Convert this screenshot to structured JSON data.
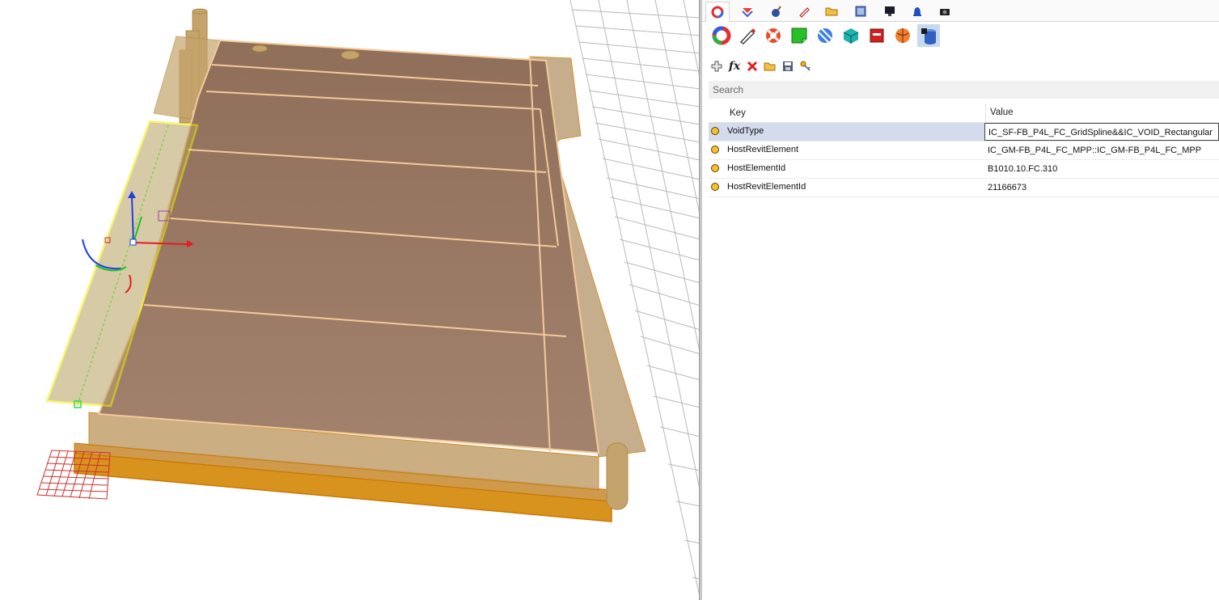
{
  "colors": {
    "accent": "#f6c12c",
    "selection": "#d3dbed",
    "model_fill": "#a58a6e",
    "edge_highlight": "#f0f000"
  },
  "tabs": [
    {
      "icon": "color-wheel-icon",
      "active": true
    },
    {
      "icon": "layers-icon",
      "active": false
    },
    {
      "icon": "bomb-icon",
      "active": false
    },
    {
      "icon": "pencil-icon",
      "active": false
    },
    {
      "icon": "folder-icon",
      "active": false
    },
    {
      "icon": "picture-icon",
      "active": false
    },
    {
      "icon": "monitor-icon",
      "active": false
    },
    {
      "icon": "bell-icon",
      "active": false
    },
    {
      "icon": "camera-icon",
      "active": false
    }
  ],
  "property_icons": [
    {
      "icon": "color-wheel-icon",
      "selected": false
    },
    {
      "icon": "pencil-icon",
      "selected": false
    },
    {
      "icon": "lifebuoy-icon",
      "selected": false
    },
    {
      "icon": "green-sheet-icon",
      "selected": false
    },
    {
      "icon": "mapping-sphere-icon",
      "selected": false
    },
    {
      "icon": "cube-icon",
      "selected": false
    },
    {
      "icon": "book-icon",
      "selected": false
    },
    {
      "icon": "ball-icon",
      "selected": false
    },
    {
      "icon": "attribute-database-icon",
      "selected": true
    }
  ],
  "toolbar": [
    "add-icon",
    "function-icon",
    "delete-icon",
    "open-folder-icon",
    "save-icon",
    "key-icon"
  ],
  "search": {
    "placeholder": "Search"
  },
  "grid": {
    "header_key": "Key",
    "header_value": "Value",
    "rows": [
      {
        "key": "VoidType",
        "value": "IC_SF-FB_P4L_FC_GridSpline&&IC_VOID_Rectangular",
        "selected": true
      },
      {
        "key": "HostRevitElement",
        "value": "IC_GM-FB_P4L_FC_MPP::IC_GM-FB_P4L_FC_MPP",
        "selected": false
      },
      {
        "key": "HostElementId",
        "value": "B1010.10.FC.310",
        "selected": false
      },
      {
        "key": "HostRevitElementId",
        "value": "21166673",
        "selected": false
      }
    ]
  }
}
